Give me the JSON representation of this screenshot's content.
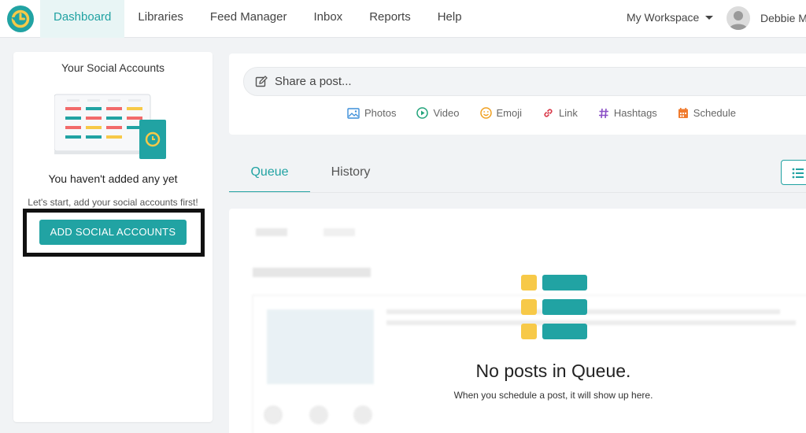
{
  "nav": {
    "items": [
      {
        "label": "Dashboard",
        "active": true
      },
      {
        "label": "Libraries",
        "active": false
      },
      {
        "label": "Feed Manager",
        "active": false
      },
      {
        "label": "Inbox",
        "active": false
      },
      {
        "label": "Reports",
        "active": false
      },
      {
        "label": "Help",
        "active": false
      }
    ],
    "workspace_label": "My Workspace",
    "user_name": "Debbie M"
  },
  "social_accounts": {
    "title": "Your Social Accounts",
    "empty_title": "You haven't added any yet",
    "empty_subtitle": "Let's start, add your social accounts first!",
    "add_button_label": "ADD SOCIAL ACCOUNTS"
  },
  "composer": {
    "placeholder": "Share a post...",
    "tools": [
      {
        "label": "Photos",
        "icon": "image-icon"
      },
      {
        "label": "Video",
        "icon": "play-icon"
      },
      {
        "label": "Emoji",
        "icon": "emoji-icon"
      },
      {
        "label": "Link",
        "icon": "link-icon"
      },
      {
        "label": "Hashtags",
        "icon": "hashtag-icon"
      },
      {
        "label": "Schedule",
        "icon": "calendar-icon"
      }
    ]
  },
  "tabs": [
    {
      "label": "Queue",
      "active": true
    },
    {
      "label": "History",
      "active": false
    }
  ],
  "queue": {
    "empty_title": "No posts in Queue.",
    "empty_subtitle": "When you schedule a post, it will show up here."
  },
  "colors": {
    "accent": "#21a3a3",
    "yellow": "#f7c948",
    "schedule_orange": "#f07b2e"
  }
}
